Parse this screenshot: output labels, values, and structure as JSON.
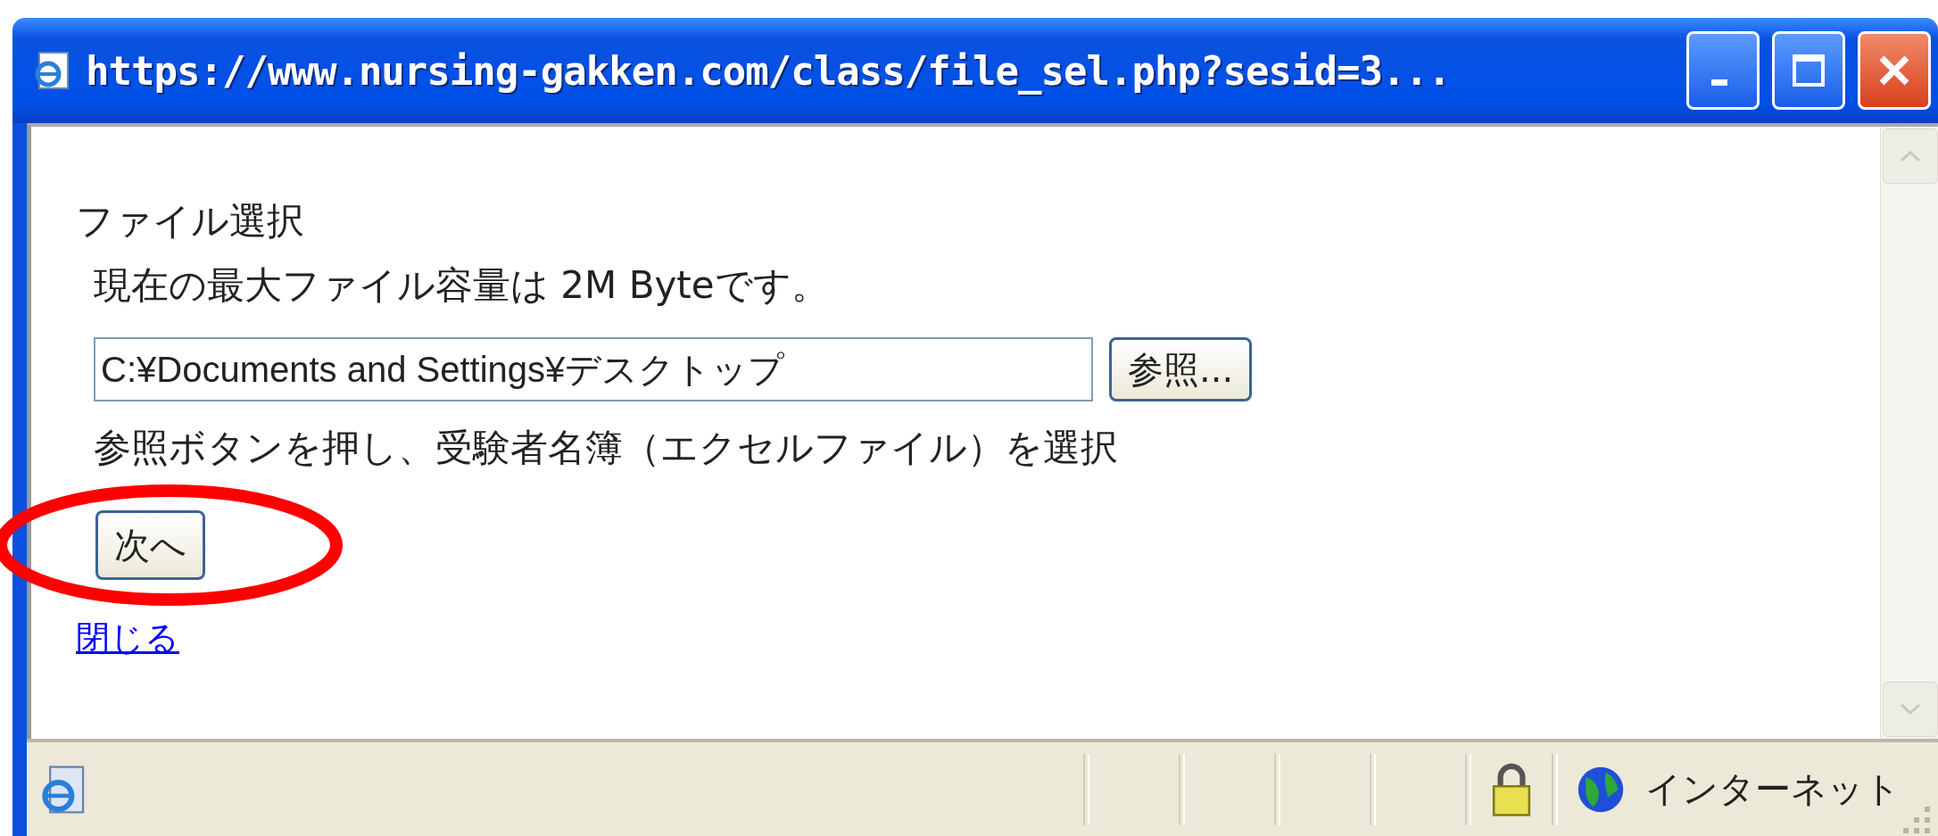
{
  "window": {
    "title": "https://www.nursing-gakken.com/class/file_sel.php?sesid=3..."
  },
  "content": {
    "heading": "ファイル選択",
    "limit_note": "現在の最大ファイル容量は 2M Byteです。",
    "file_field": {
      "value": "C:¥Documents and Settings¥デスクトップ"
    },
    "browse_button": "参照...",
    "instruction": "参照ボタンを押し、受験者名簿（エクセルファイル）を選択",
    "next_button": "次へ",
    "close_link": "閉じる"
  },
  "status_bar": {
    "zone": "インターネット"
  }
}
